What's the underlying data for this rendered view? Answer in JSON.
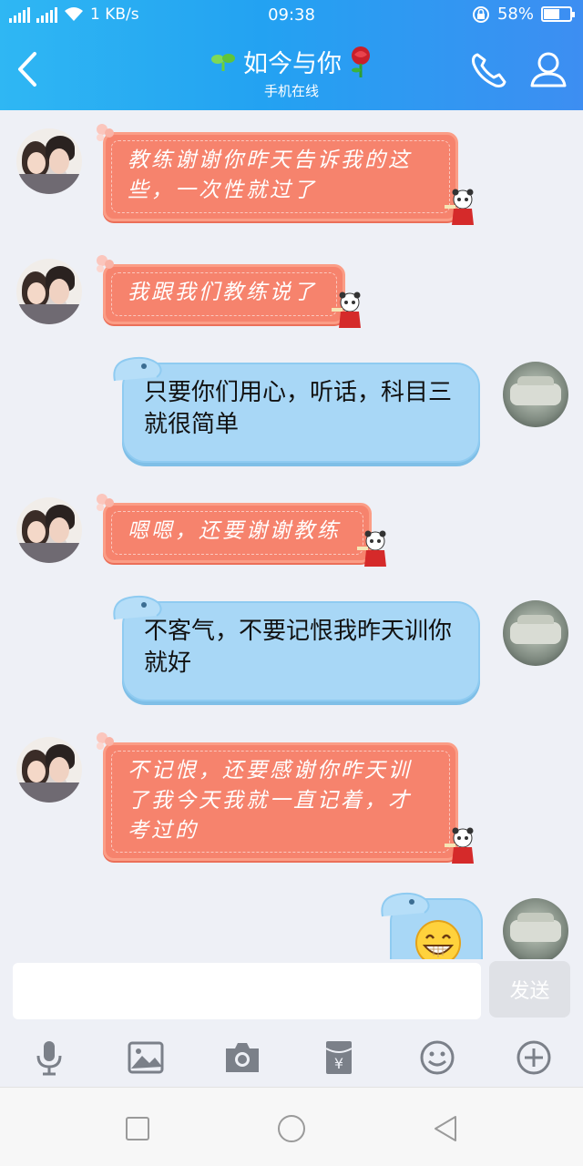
{
  "status_bar": {
    "network": "1 KB/s",
    "time": "09:38",
    "battery": "58%"
  },
  "header": {
    "title": "如今与你",
    "subtitle": "手机在线"
  },
  "messages": [
    {
      "side": "left",
      "text": "教练谢谢你昨天告诉我的这些，一次性就过了"
    },
    {
      "side": "left",
      "text": "我跟我们教练说了"
    },
    {
      "side": "right",
      "text": "只要你们用心，听话，科目三就很简单"
    },
    {
      "side": "left",
      "text": "嗯嗯，还要谢谢教练"
    },
    {
      "side": "right",
      "text": "不客气，不要记恨我昨天训你就好"
    },
    {
      "side": "left",
      "text": "不记恨，还要感谢你昨天训了我今天我就一直记着，才考过的"
    },
    {
      "side": "right",
      "text": "",
      "emoji": "grin-emoji"
    }
  ],
  "input": {
    "value": "",
    "send_label": "发送"
  },
  "toolbar": [
    "mic-icon",
    "image-icon",
    "camera-icon",
    "red-packet-icon",
    "emoji-icon",
    "plus-icon"
  ],
  "nav": [
    "recent-apps-icon",
    "home-icon",
    "back-triangle-icon"
  ],
  "colors": {
    "header_start": "#2fb7f3",
    "header_end": "#3d8ef2",
    "left_bubble": "#f6836d",
    "right_bubble": "#a8d7f6"
  }
}
